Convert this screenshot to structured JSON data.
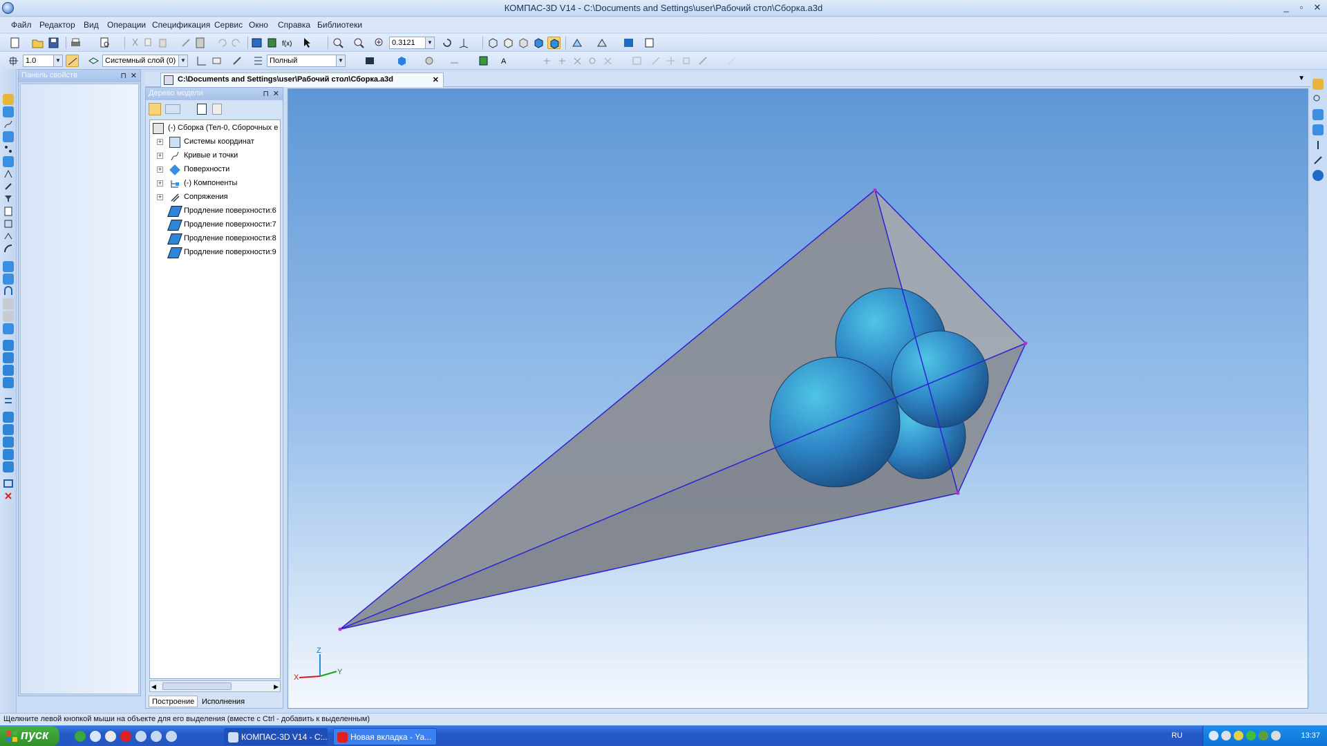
{
  "window": {
    "title": "КОМПАС-3D V14 - C:\\Documents and Settings\\user\\Рабочий стол\\Сборка.a3d",
    "minimize": "_",
    "maximize": "▫",
    "close": "✕"
  },
  "menu": {
    "items": [
      "Файл",
      "Редактор",
      "Вид",
      "Операции",
      "Спецификация",
      "Сервис",
      "Окно",
      "Справка",
      "Библиотеки"
    ]
  },
  "toolbar1": {
    "zoom_value": "0.3121"
  },
  "toolbar2": {
    "step_value": "1.0",
    "layer_value": "Системный слой (0)",
    "mode_value": "Полный"
  },
  "properties_panel": {
    "title": "Панель свойств",
    "pin": "⊓",
    "close": "✕"
  },
  "document_tab": {
    "label": "C:\\Documents and Settings\\user\\Рабочий стол\\Сборка.a3d",
    "close": "✕",
    "dropdown": "▼"
  },
  "model_tree": {
    "title": "Дерево модели",
    "pin": "⊓",
    "close": "✕",
    "root": "(-) Сборка (Тел-0, Сборочных е",
    "nodes": [
      {
        "label": "Системы координат",
        "expand": "+",
        "icon": "coordinate-systems-icon"
      },
      {
        "label": "Кривые и точки",
        "expand": "+",
        "icon": "curves-icon"
      },
      {
        "label": "Поверхности",
        "expand": "+",
        "icon": "surfaces-icon"
      },
      {
        "label": "(-) Компоненты",
        "expand": "+",
        "icon": "components-icon"
      },
      {
        "label": "Сопряжения",
        "expand": "+",
        "icon": "mates-icon"
      },
      {
        "label": "Продление поверхности:6",
        "expand": "",
        "icon": "surface-extension-icon"
      },
      {
        "label": "Продление поверхности:7",
        "expand": "",
        "icon": "surface-extension-icon"
      },
      {
        "label": "Продление поверхности:8",
        "expand": "",
        "icon": "surface-extension-icon"
      },
      {
        "label": "Продление поверхности:9",
        "expand": "",
        "icon": "surface-extension-icon"
      }
    ],
    "tabs": [
      "Построение",
      "Исполнения"
    ]
  },
  "viewport": {
    "axis_x": "X",
    "axis_y": "Y",
    "axis_z": "Z",
    "pyramid_color": "#9a9ea6",
    "sphere_color": "#2f8fcc",
    "edge_color": "#2a22d8"
  },
  "status": {
    "text": "Щелкните левой кнопкой мыши на объекте для его выделения (вместе с Ctrl - добавить к выделенным)"
  },
  "taskbar": {
    "start": "пуск",
    "tasks": [
      {
        "label": "КОМПАС-3D V14 - C:..."
      },
      {
        "label": "Новая вкладка - Ya..."
      }
    ],
    "lang": "RU",
    "clock": "13:37"
  }
}
